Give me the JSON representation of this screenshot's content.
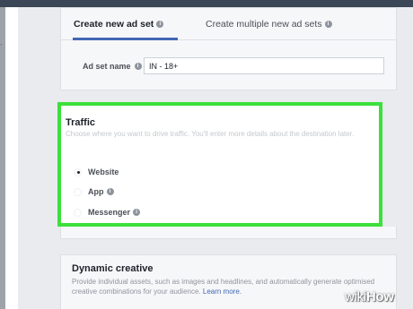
{
  "tabs": {
    "active_label": "Create new ad set",
    "inactive_label": "Create multiple new ad sets",
    "info_glyph": "i"
  },
  "ad_set": {
    "name_label": "Ad set name",
    "name_value": "IN - 18+"
  },
  "traffic": {
    "title": "Traffic",
    "description": "Choose where you want to drive traffic. You'll enter more details about the destination later.",
    "options": [
      {
        "label": "Website",
        "checked": true
      },
      {
        "label": "App",
        "checked": false
      },
      {
        "label": "Messenger",
        "checked": false
      }
    ],
    "highlight_color": "#3be03b"
  },
  "dynamic_creative": {
    "title": "Dynamic creative",
    "description": "Provide individual assets, such as images and headlines, and automatically generate optimised creative combinations for your audience.",
    "learn_more": "Learn more."
  },
  "watermark": {
    "prefix": "wiki",
    "suffix": "How"
  },
  "colors": {
    "accent": "#4267b2",
    "topbar": "#3b4656"
  }
}
